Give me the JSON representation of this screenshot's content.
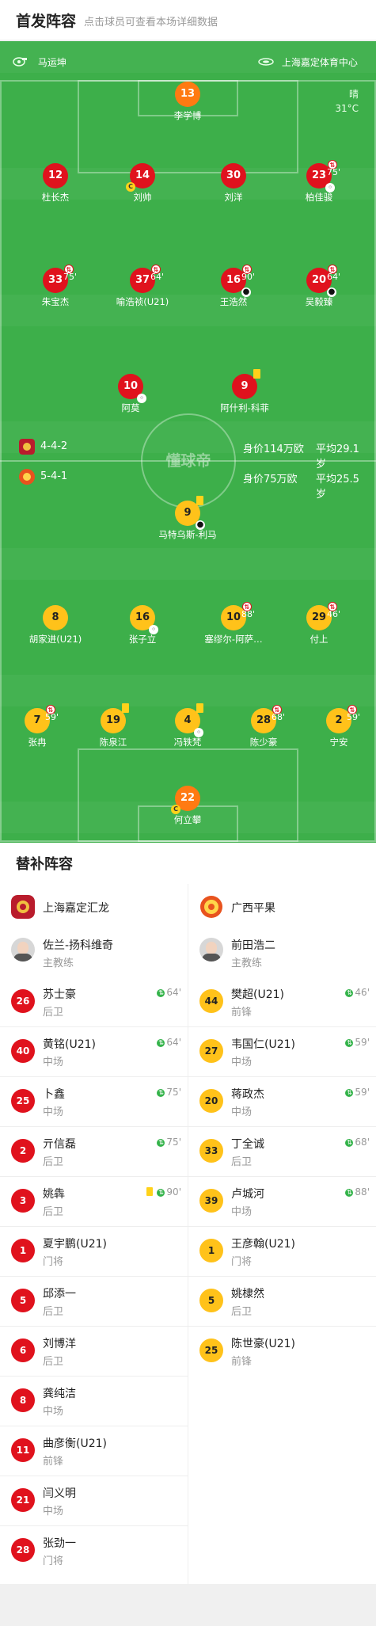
{
  "header": {
    "title": "首发阵容",
    "hint": "点击球员可查看本场详细数据"
  },
  "match_info": {
    "referee": "马运坤",
    "stadium": "上海嘉定体育中心",
    "weather": "晴",
    "temperature": "31°C"
  },
  "icons": {
    "referee": "whistle-icon",
    "stadium": "stadium-icon",
    "substitution": "sub-arrow-icon",
    "captain": "captain-badge-icon",
    "yellow_card": "yellow-card-icon",
    "goal": "ball-icon"
  },
  "colors": {
    "home": "#e0121d",
    "away": "#ffc21a",
    "goalkeeper": "#ff7a12",
    "pitch": "#3daf4a"
  },
  "field_logo": "懂球帝",
  "home_team": {
    "name": "上海嘉定汇龙",
    "formation": "4-4-2",
    "value": "身价114万欧",
    "avg_age": "平均29.1岁",
    "starters": [
      {
        "number": "13",
        "name": "李学博"
      },
      {
        "number": "12",
        "name": "杜长杰"
      },
      {
        "number": "14",
        "name": "刘帅",
        "captain": "C"
      },
      {
        "number": "30",
        "name": "刘洋"
      },
      {
        "number": "23",
        "name": "柏佳骏",
        "sub_time": "75'"
      },
      {
        "number": "33",
        "name": "朱宝杰",
        "sub_time": "75'"
      },
      {
        "number": "37",
        "name": "喻浩祯(U21)",
        "sub_time": "64'"
      },
      {
        "number": "16",
        "name": "王浩然",
        "sub_time": "90'"
      },
      {
        "number": "20",
        "name": "吴毅臻",
        "sub_time": "64'"
      },
      {
        "number": "10",
        "name": "阿莫"
      },
      {
        "number": "9",
        "name": "阿什利-科菲"
      }
    ],
    "coach": {
      "name": "佐兰-扬科维奇",
      "role": "主教练"
    },
    "subs": [
      {
        "number": "26",
        "name": "苏士豪",
        "pos": "后卫",
        "time": "64'"
      },
      {
        "number": "40",
        "name": "黄铭(U21)",
        "pos": "中场",
        "time": "64'"
      },
      {
        "number": "25",
        "name": "卜鑫",
        "pos": "中场",
        "time": "75'"
      },
      {
        "number": "2",
        "name": "亓信磊",
        "pos": "后卫",
        "time": "75'"
      },
      {
        "number": "3",
        "name": "姚犇",
        "pos": "后卫",
        "time": "90'"
      },
      {
        "number": "1",
        "name": "夏宇鹏(U21)",
        "pos": "门将",
        "time": ""
      },
      {
        "number": "5",
        "name": "邱添一",
        "pos": "后卫",
        "time": ""
      },
      {
        "number": "6",
        "name": "刘博洋",
        "pos": "后卫",
        "time": ""
      },
      {
        "number": "8",
        "name": "龚纯洁",
        "pos": "中场",
        "time": ""
      },
      {
        "number": "11",
        "name": "曲彦衡(U21)",
        "pos": "前锋",
        "time": ""
      },
      {
        "number": "21",
        "name": "闫义明",
        "pos": "中场",
        "time": ""
      },
      {
        "number": "28",
        "name": "张劲一",
        "pos": "门将",
        "time": ""
      }
    ]
  },
  "away_team": {
    "name": "广西平果",
    "formation": "5-4-1",
    "value": "身价75万欧",
    "avg_age": "平均25.5岁",
    "starters": [
      {
        "number": "9",
        "name": "马特乌斯-利马"
      },
      {
        "number": "8",
        "name": "胡家进(U21)"
      },
      {
        "number": "16",
        "name": "张子立"
      },
      {
        "number": "10",
        "name": "塞缪尔-阿萨…",
        "sub_time": "88'"
      },
      {
        "number": "29",
        "name": "付上",
        "sub_time": "46'"
      },
      {
        "number": "7",
        "name": "张冉",
        "sub_time": "59'"
      },
      {
        "number": "19",
        "name": "陈泉江"
      },
      {
        "number": "4",
        "name": "冯轶梵"
      },
      {
        "number": "28",
        "name": "陈少豪",
        "sub_time": "68'"
      },
      {
        "number": "2",
        "name": "宁安",
        "sub_time": "59'"
      },
      {
        "number": "22",
        "name": "何立攀",
        "captain": "C"
      }
    ],
    "coach": {
      "name": "前田浩二",
      "role": "主教练"
    },
    "subs": [
      {
        "number": "44",
        "name": "樊超(U21)",
        "pos": "前锋",
        "time": "46'"
      },
      {
        "number": "27",
        "name": "韦国仁(U21)",
        "pos": "中场",
        "time": "59'"
      },
      {
        "number": "20",
        "name": "蒋政杰",
        "pos": "中场",
        "time": "59'"
      },
      {
        "number": "33",
        "name": "丁全诚",
        "pos": "后卫",
        "time": "68'"
      },
      {
        "number": "39",
        "name": "卢城河",
        "pos": "中场",
        "time": "88'"
      },
      {
        "number": "1",
        "name": "王彦翰(U21)",
        "pos": "门将",
        "time": ""
      },
      {
        "number": "5",
        "name": "姚棣然",
        "pos": "后卫",
        "time": ""
      },
      {
        "number": "25",
        "name": "陈世豪(U21)",
        "pos": "前锋",
        "time": ""
      }
    ]
  },
  "subs_title": "替补阵容"
}
